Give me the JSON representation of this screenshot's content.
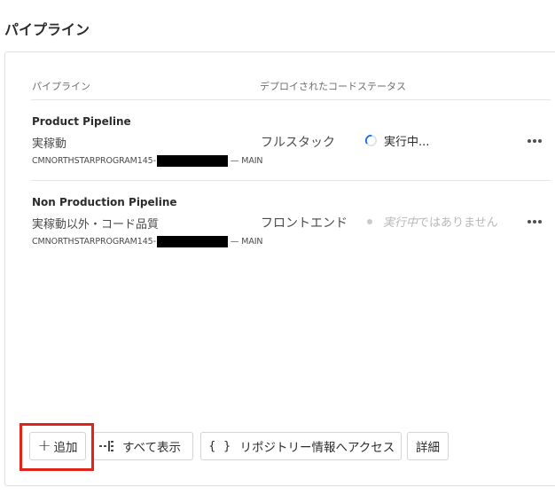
{
  "page": {
    "title": "パイプライン"
  },
  "table": {
    "headers": {
      "pipeline": "パイプライン",
      "status": "デプロイされたコードステータス"
    },
    "rows": [
      {
        "name": "Product Pipeline",
        "environment": "実稼動",
        "repo_prefix": "CMNORTHSTARPROGRAM145-",
        "repo_suffix": "— MAIN",
        "type": "フルスタック",
        "status": "実行中..."
      },
      {
        "name": "Non Production Pipeline",
        "environment": "実稼動以外・コード品質",
        "repo_prefix": "CMNORTHSTARPROGRAM145-",
        "repo_suffix": "— MAIN",
        "type": "フロントエンド",
        "status_em": "実行中",
        "status_rest": "ではありません"
      }
    ]
  },
  "actions": {
    "add": "追加",
    "show_all": "すべて表示",
    "repo_braces": "{ }",
    "repo_access": "リポジトリー情報へアクセス",
    "details": "詳細"
  },
  "colors": {
    "highlight": "#e2231a",
    "spinner": "#1473e6",
    "divider": "#e4e4e4"
  },
  "icons": {
    "add": "plus-icon",
    "show_all": "pipeline-grid-icon",
    "repo": "braces-icon",
    "more": "more-horizontal-icon",
    "running": "spinner-icon",
    "idle": "status-dot-icon"
  }
}
